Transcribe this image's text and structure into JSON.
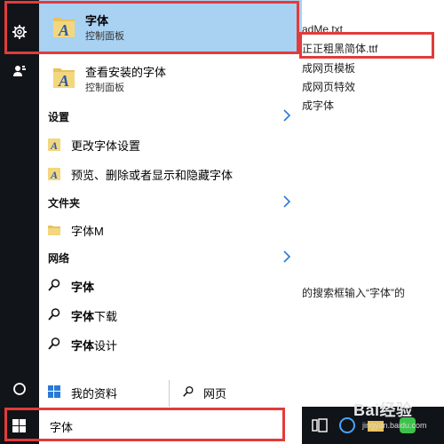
{
  "document": {
    "lines": [
      "adMe.txt",
      "正正粗黑简体.ttf",
      "成网页模板",
      "成网页特效",
      "成字体"
    ],
    "caption": "的搜索框输入“字体”的"
  },
  "rail": {
    "icons": [
      "gear-icon",
      "user-icon",
      "power-icon",
      "windows-logo-icon"
    ]
  },
  "top_result": {
    "title": "字体",
    "subtitle": "控制面板"
  },
  "second_result": {
    "title": "查看安装的字体",
    "subtitle": "控制面板"
  },
  "sections": {
    "settings": {
      "heading": "设置",
      "items": [
        "更改字体设置",
        "预览、删除或者显示和隐藏字体"
      ]
    },
    "folders": {
      "heading": "文件夹",
      "items": [
        "字体M"
      ]
    },
    "web": {
      "heading": "网络",
      "items": [
        {
          "bold": "字体",
          "rest": ""
        },
        {
          "bold": "字体",
          "rest": "下载"
        },
        {
          "bold": "字体",
          "rest": "设计"
        }
      ]
    }
  },
  "bottom_tabs": {
    "my_stuff": "我的资料",
    "web": "网页"
  },
  "taskbar": {
    "search_text": "字体"
  },
  "watermark": {
    "main": "Bai经验",
    "sub": "jingyan.baidu.com"
  },
  "colors": {
    "highlight": "#a9d1f2",
    "rail": "#111418",
    "annotation": "#e23b3b"
  }
}
